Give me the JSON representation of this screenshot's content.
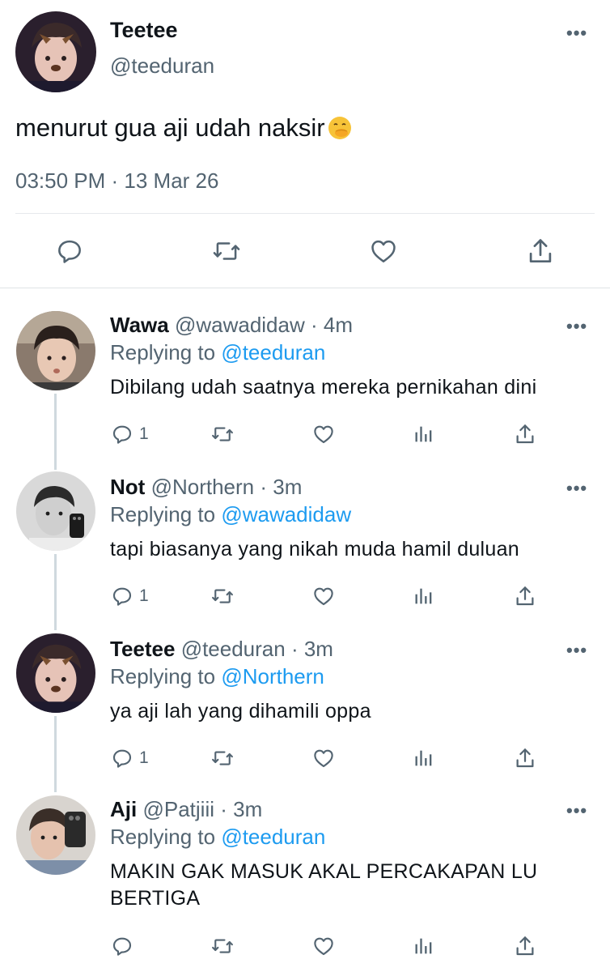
{
  "colors": {
    "text": "#0f1419",
    "secondary": "#536471",
    "link": "#1d9bf0",
    "divider": "#e6e9ec"
  },
  "main_tweet": {
    "name": "Teetee",
    "handle": "@teeduran",
    "text": "menurut gua aji udah naksir",
    "emoji": "face-with-hand-over-mouth-emoji",
    "time": "03:50 PM · 13 Mar 26",
    "actions": [
      "reply-icon",
      "retweet-icon",
      "like-icon",
      "share-icon"
    ]
  },
  "replies": [
    {
      "name": "Wawa",
      "handle": "@wawadidaw",
      "age": "· 4m",
      "replying_prefix": "Replying to ",
      "replying_to": "@teeduran",
      "text": "Dibilang udah saatnya mereka pernikahan dini",
      "reply_count": "1"
    },
    {
      "name": "Not",
      "handle": "@Northern",
      "age": "· 3m",
      "replying_prefix": "Replying to ",
      "replying_to": "@wawadidaw",
      "text": "tapi biasanya yang nikah muda hamil duluan",
      "reply_count": "1"
    },
    {
      "name": "Teetee",
      "handle": "@teeduran",
      "age": "· 3m",
      "replying_prefix": "Replying to ",
      "replying_to": "@Northern",
      "text": "ya aji lah yang dihamili oppa",
      "reply_count": "1"
    },
    {
      "name": "Aji",
      "handle": "@Patjiii",
      "age": "· 3m",
      "replying_prefix": "Replying to ",
      "replying_to": "@teeduran",
      "text": "MAKIN GAK MASUK AKAL PERCAKAPAN LU BERTIGA",
      "reply_count": ""
    }
  ],
  "more_label": "•••"
}
